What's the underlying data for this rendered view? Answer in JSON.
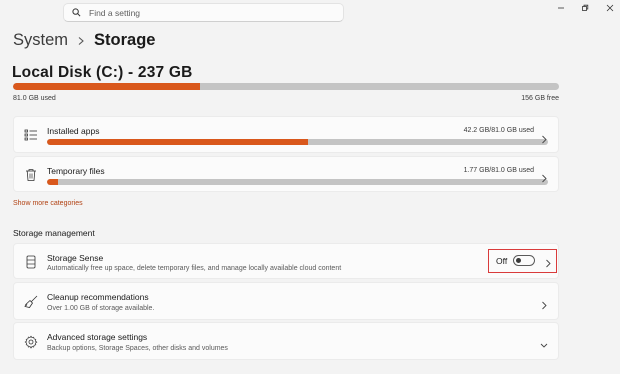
{
  "search": {
    "placeholder": "Find a setting"
  },
  "breadcrumb": {
    "parent": "System",
    "current": "Storage"
  },
  "disk": {
    "title": "Local Disk (C:) - 237 GB",
    "used_label": "81.0 GB used",
    "free_label": "156 GB free",
    "used_fraction": 0.342
  },
  "categories": [
    {
      "label": "Installed apps",
      "value": "42.2 GB/81.0 GB used",
      "fraction": 0.52,
      "icon": "list-icon"
    },
    {
      "label": "Temporary files",
      "value": "1.77 GB/81.0 GB used",
      "fraction": 0.022,
      "icon": "trash-icon"
    }
  ],
  "show_more": "Show more categories",
  "storage_management": {
    "heading": "Storage management",
    "storage_sense": {
      "title": "Storage Sense",
      "description": "Automatically free up space, delete temporary files, and manage locally available cloud content",
      "toggle_label": "Off",
      "toggle_on": false
    },
    "cleanup": {
      "title": "Cleanup recommendations",
      "description": "Over 1.00 GB of storage available."
    },
    "advanced": {
      "title": "Advanced storage settings",
      "description": "Backup options, Storage Spaces, other disks and volumes"
    }
  },
  "colors": {
    "accent": "#d9581c",
    "bar_bg": "#c4c4c4",
    "highlight": "#d93b3b"
  }
}
